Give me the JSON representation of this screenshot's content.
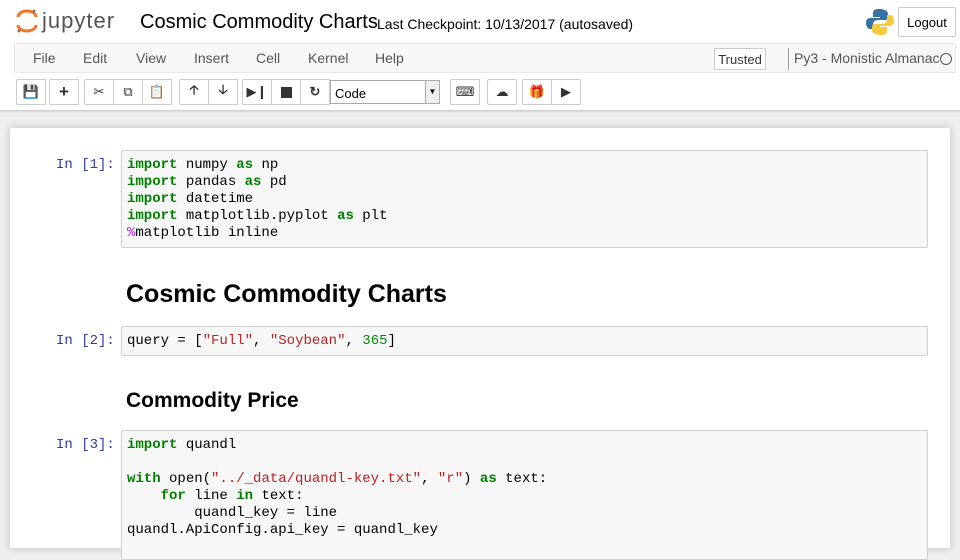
{
  "header": {
    "logo_text": "jupyter",
    "notebook_title": "Cosmic Commodity Charts",
    "checkpoint": "Last Checkpoint: 10/13/2017 (autosaved)",
    "logout_label": "Logout"
  },
  "menubar": {
    "items": [
      "File",
      "Edit",
      "View",
      "Insert",
      "Cell",
      "Kernel",
      "Help"
    ],
    "trusted_label": "Trusted",
    "kernel_name": "Py3 - Monistic Almanac"
  },
  "toolbar": {
    "icons": [
      "save-icon",
      "plus-icon",
      "cut-icon",
      "copy-icon",
      "paste-icon",
      "arrow-up-icon",
      "arrow-down-icon",
      "step-forward-icon",
      "stop-icon",
      "restart-icon",
      "keyboard-icon",
      "cloud-upload-icon",
      "gift-icon",
      "play-icon"
    ],
    "cell_type": "Code"
  },
  "cells": [
    {
      "prompt": "In [1]:",
      "lines": [
        [
          [
            "import",
            "kw"
          ],
          [
            " numpy ",
            ""
          ],
          [
            "as",
            "kw"
          ],
          [
            " np",
            ""
          ]
        ],
        [
          [
            "import",
            "kw"
          ],
          [
            " pandas ",
            ""
          ],
          [
            "as",
            "kw"
          ],
          [
            " pd",
            ""
          ]
        ],
        [
          [
            "import",
            "kw"
          ],
          [
            " datetime",
            ""
          ]
        ],
        [
          [
            "import",
            "kw"
          ],
          [
            " matplotlib.pyplot ",
            ""
          ],
          [
            "as",
            "kw"
          ],
          [
            " plt",
            ""
          ]
        ],
        [
          [
            "%",
            "mag"
          ],
          [
            "matplotlib inline",
            ""
          ]
        ]
      ]
    },
    {
      "heading": "Cosmic Commodity Charts"
    },
    {
      "prompt": "In [2]:",
      "lines": [
        [
          [
            "query = [",
            ""
          ],
          [
            "\"Full\"",
            "str"
          ],
          [
            ", ",
            ""
          ],
          [
            "\"Soybean\"",
            "str"
          ],
          [
            ", ",
            ""
          ],
          [
            "365",
            "num"
          ],
          [
            "]",
            ""
          ]
        ]
      ]
    },
    {
      "heading2": "Commodity Price"
    },
    {
      "prompt": "In [3]:",
      "lines": [
        [
          [
            "import",
            "kw"
          ],
          [
            " quandl",
            ""
          ]
        ],
        [
          [
            "",
            ""
          ]
        ],
        [
          [
            "with",
            "kw"
          ],
          [
            " open(",
            ""
          ],
          [
            "\"../_data/quandl-key.txt\"",
            "str"
          ],
          [
            ", ",
            ""
          ],
          [
            "\"r\"",
            "str"
          ],
          [
            ") ",
            ""
          ],
          [
            "as",
            "kw"
          ],
          [
            " text:",
            ""
          ]
        ],
        [
          [
            "    ",
            ""
          ],
          [
            "for",
            "kw"
          ],
          [
            " line ",
            ""
          ],
          [
            "in",
            "kw"
          ],
          [
            " text:",
            ""
          ]
        ],
        [
          [
            "        quandl_key = line",
            ""
          ]
        ],
        [
          [
            "quandl.ApiConfig.api_key = quandl_key",
            ""
          ]
        ]
      ]
    }
  ],
  "colors": {
    "prompt": "#303f9f",
    "keyword": "#008000",
    "string": "#ba2121",
    "magic": "#aa22ff"
  }
}
